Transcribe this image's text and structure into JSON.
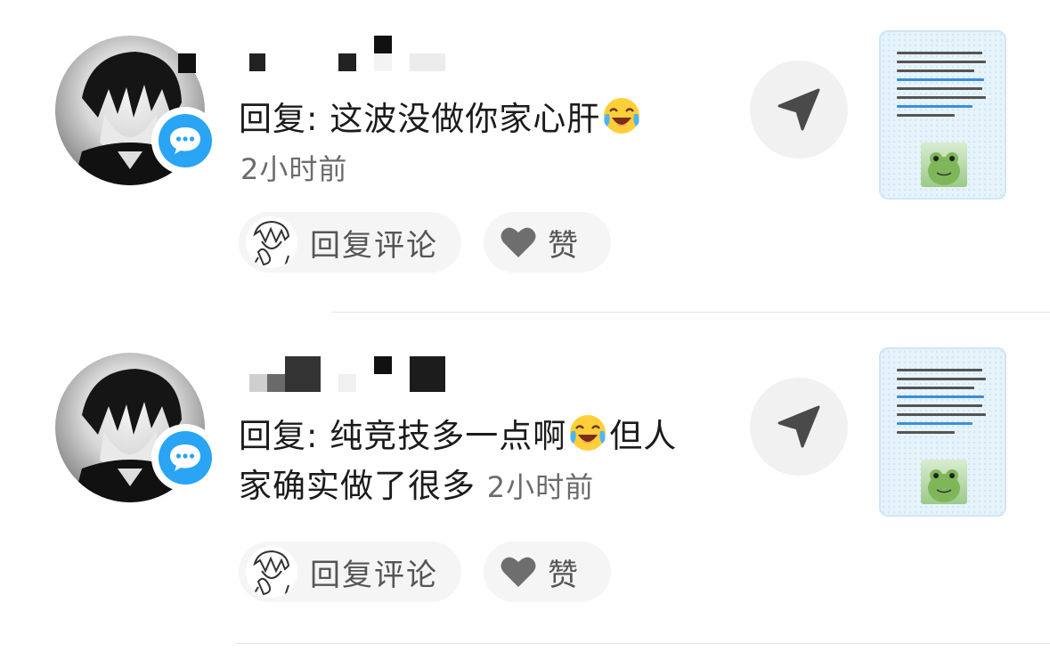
{
  "comments": [
    {
      "reply_prefix": "回复: ",
      "text_before": "这波没做你家心肝",
      "text_after": "",
      "text_line2": "",
      "time": "2小时前",
      "reply_button": "回复评论",
      "like_button": "赞"
    },
    {
      "reply_prefix": "回复: ",
      "text_before": "纯竞技多一点啊",
      "text_after": "但人",
      "text_line2": "家确实做了很多",
      "time": "2小时前",
      "reply_button": "回复评论",
      "like_button": "赞"
    }
  ],
  "colors": {
    "badge": "#2aa4f4",
    "pill_bg": "#f5f5f5",
    "send_bg": "#f1f1f1",
    "text": "#1b1b1b",
    "muted": "#6b6b6b"
  },
  "icons": {
    "badge": "chat-bubble-icon",
    "send": "send-arrow-icon",
    "like": "heart-icon",
    "emoji": "crying-laughing-emoji-icon"
  }
}
